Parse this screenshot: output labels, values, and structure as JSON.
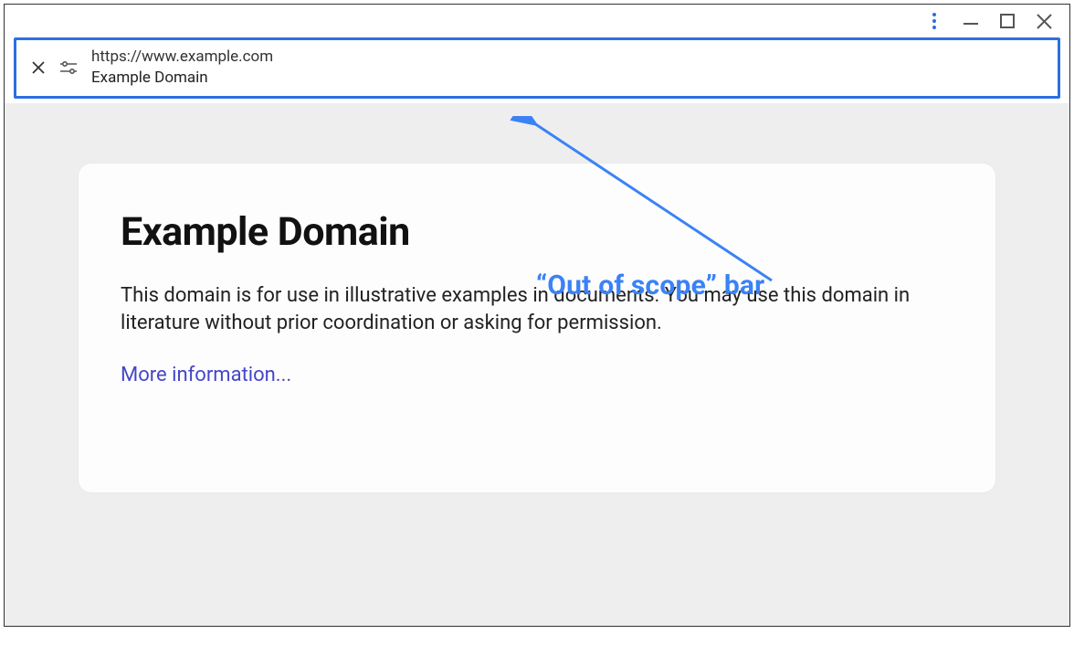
{
  "title_bar": {
    "kebab_label": "More",
    "minimize_label": "Minimize",
    "maximize_label": "Maximize",
    "close_label": "Close"
  },
  "address_bar": {
    "url": "https://www.example.com",
    "page_title": "Example Domain"
  },
  "page": {
    "heading": "Example Domain",
    "body": "This domain is for use in illustrative examples in documents. You may use this domain in literature without prior coordination or asking for permission.",
    "more_link": "More information..."
  },
  "annotation": {
    "label": "“Out of scope” bar"
  }
}
